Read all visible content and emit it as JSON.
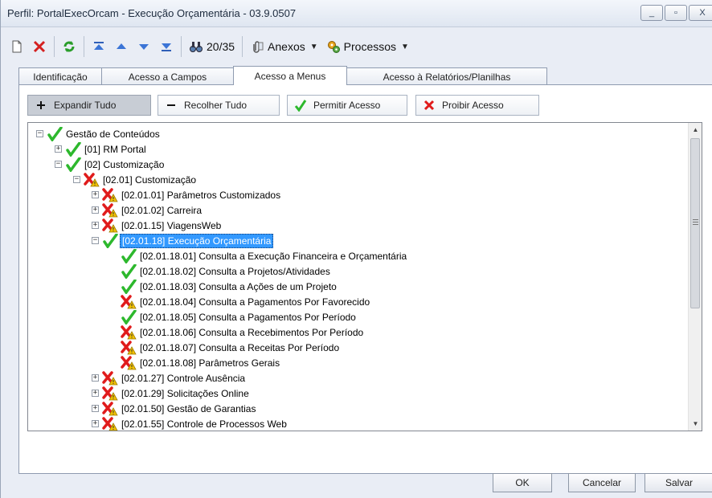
{
  "window": {
    "title": "Perfil: PortalExecOrcam - Execução Orçamentária - 03.9.0507",
    "minimize": "_",
    "maximize": "▫",
    "close": "X"
  },
  "toolbar": {
    "record_counter": "20/35",
    "attachments_label": "Anexos",
    "processes_label": "Processos"
  },
  "tabs": [
    {
      "label": "Identificação",
      "active": false
    },
    {
      "label": "Acesso a Campos",
      "active": false
    },
    {
      "label": "Acesso a Menus",
      "active": true
    },
    {
      "label": "Acesso à Relatórios/Planilhas",
      "active": false
    }
  ],
  "actions": {
    "expand_all": "Expandir Tudo",
    "collapse_all": "Recolher Tudo",
    "allow_access": "Permitir Acesso",
    "deny_access": "Proibir Acesso"
  },
  "tree": [
    {
      "label": "Gestão de Conteúdos",
      "level": 0,
      "expander": "minus",
      "status": "allowed"
    },
    {
      "label": "[01] RM Portal",
      "level": 1,
      "expander": "plus",
      "status": "allowed"
    },
    {
      "label": "[02] Customização",
      "level": 1,
      "expander": "minus",
      "status": "allowed"
    },
    {
      "label": "[02.01] Customização",
      "level": 2,
      "expander": "minus",
      "status": "denied"
    },
    {
      "label": "[02.01.01] Parâmetros Customizados",
      "level": 3,
      "expander": "plus",
      "status": "denied"
    },
    {
      "label": "[02.01.02] Carreira",
      "level": 3,
      "expander": "plus",
      "status": "denied"
    },
    {
      "label": "[02.01.15] ViagensWeb",
      "level": 3,
      "expander": "plus",
      "status": "denied"
    },
    {
      "label": "[02.01.18] Execução Orçamentária",
      "level": 3,
      "expander": "minus",
      "status": "allowed",
      "selected": true
    },
    {
      "label": "[02.01.18.01] Consulta a Execução Financeira e Orçamentária",
      "level": 4,
      "expander": "none",
      "status": "allowed"
    },
    {
      "label": "[02.01.18.02] Consulta a Projetos/Atividades",
      "level": 4,
      "expander": "none",
      "status": "allowed"
    },
    {
      "label": "[02.01.18.03] Consulta a Ações de um Projeto",
      "level": 4,
      "expander": "none",
      "status": "allowed"
    },
    {
      "label": "[02.01.18.04] Consulta a Pagamentos Por Favorecido",
      "level": 4,
      "expander": "none",
      "status": "denied"
    },
    {
      "label": "[02.01.18.05] Consulta a Pagamentos Por Período",
      "level": 4,
      "expander": "none",
      "status": "allowed"
    },
    {
      "label": "[02.01.18.06] Consulta a Recebimentos Por Período",
      "level": 4,
      "expander": "none",
      "status": "denied"
    },
    {
      "label": "[02.01.18.07] Consulta a Receitas Por Período",
      "level": 4,
      "expander": "none",
      "status": "denied"
    },
    {
      "label": "[02.01.18.08] Parâmetros Gerais",
      "level": 4,
      "expander": "none",
      "status": "denied"
    },
    {
      "label": "[02.01.27] Controle Ausência",
      "level": 3,
      "expander": "plus",
      "status": "denied"
    },
    {
      "label": "[02.01.29] Solicitações Online",
      "level": 3,
      "expander": "plus",
      "status": "denied"
    },
    {
      "label": "[02.01.50] Gestão de Garantias",
      "level": 3,
      "expander": "plus",
      "status": "denied"
    },
    {
      "label": "[02.01.55] Controle de Processos Web",
      "level": 3,
      "expander": "plus",
      "status": "denied"
    }
  ],
  "footer": {
    "ok": "OK",
    "cancel": "Cancelar",
    "save": "Salvar"
  },
  "colors": {
    "allowed": "#2db82d",
    "denied": "#e01b1b",
    "warning": "#f2c200",
    "selection": "#3399ff"
  }
}
